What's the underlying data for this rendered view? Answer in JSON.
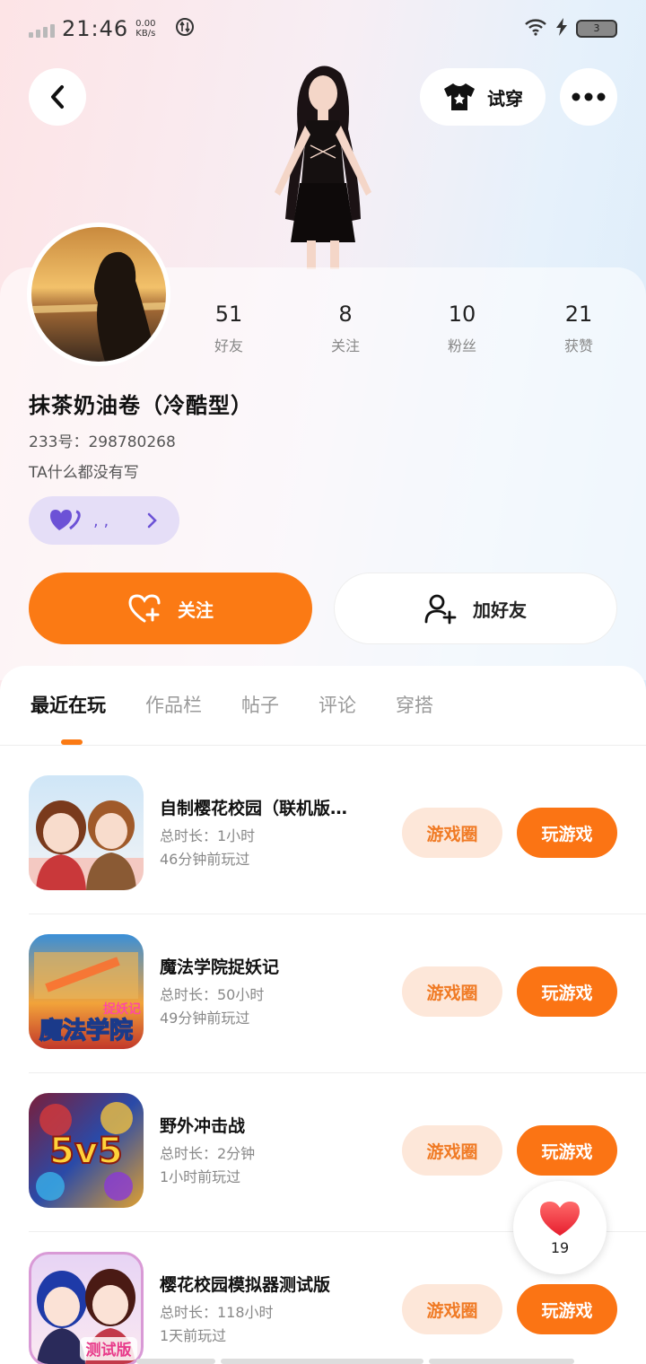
{
  "status_bar": {
    "time": "21:46",
    "net_speed_value": "0.00",
    "net_speed_unit": "KB/s",
    "battery": "3"
  },
  "header": {
    "try_on_label": "试穿"
  },
  "profile": {
    "stats": [
      {
        "value": "51",
        "label": "好友"
      },
      {
        "value": "8",
        "label": "关注"
      },
      {
        "value": "10",
        "label": "粉丝"
      },
      {
        "value": "21",
        "label": "获赞"
      }
    ],
    "name": "抹茶奶油卷（冷酷型）",
    "id_text": "233号：298780268",
    "bio": "TA什么都没有写",
    "badge_text": ", ,"
  },
  "actions": {
    "follow_label": "关注",
    "add_friend_label": "加好友"
  },
  "tabs": [
    {
      "label": "最近在玩"
    },
    {
      "label": "作品栏"
    },
    {
      "label": "帖子"
    },
    {
      "label": "评论"
    },
    {
      "label": "穿搭"
    }
  ],
  "games": [
    {
      "title": "自制樱花校园（联机版…",
      "duration": "总时长：1小时",
      "last_played": "46分钟前玩过",
      "circle_label": "游戏圈",
      "play_label": "玩游戏"
    },
    {
      "title": "魔法学院捉妖记",
      "duration": "总时长：50小时",
      "last_played": "49分钟前玩过",
      "circle_label": "游戏圈",
      "play_label": "玩游戏"
    },
    {
      "title": "野外冲击战",
      "duration": "总时长：2分钟",
      "last_played": "1小时前玩过",
      "circle_label": "游戏圈",
      "play_label": "玩游戏"
    },
    {
      "title": "樱花校园模拟器测试版",
      "duration": "总时长：118小时",
      "last_played": "1天前玩过",
      "circle_label": "游戏圈",
      "play_label": "玩游戏"
    }
  ],
  "game_icon_text": {
    "magic": "魔法学院",
    "magic_tag": "捉妖记",
    "moba": "5v5",
    "test": "测试版"
  },
  "like": {
    "count": "19"
  },
  "colors": {
    "accent": "#fb7a14",
    "accent_light": "#fde7d9",
    "badge_purple": "#6c52d6"
  }
}
